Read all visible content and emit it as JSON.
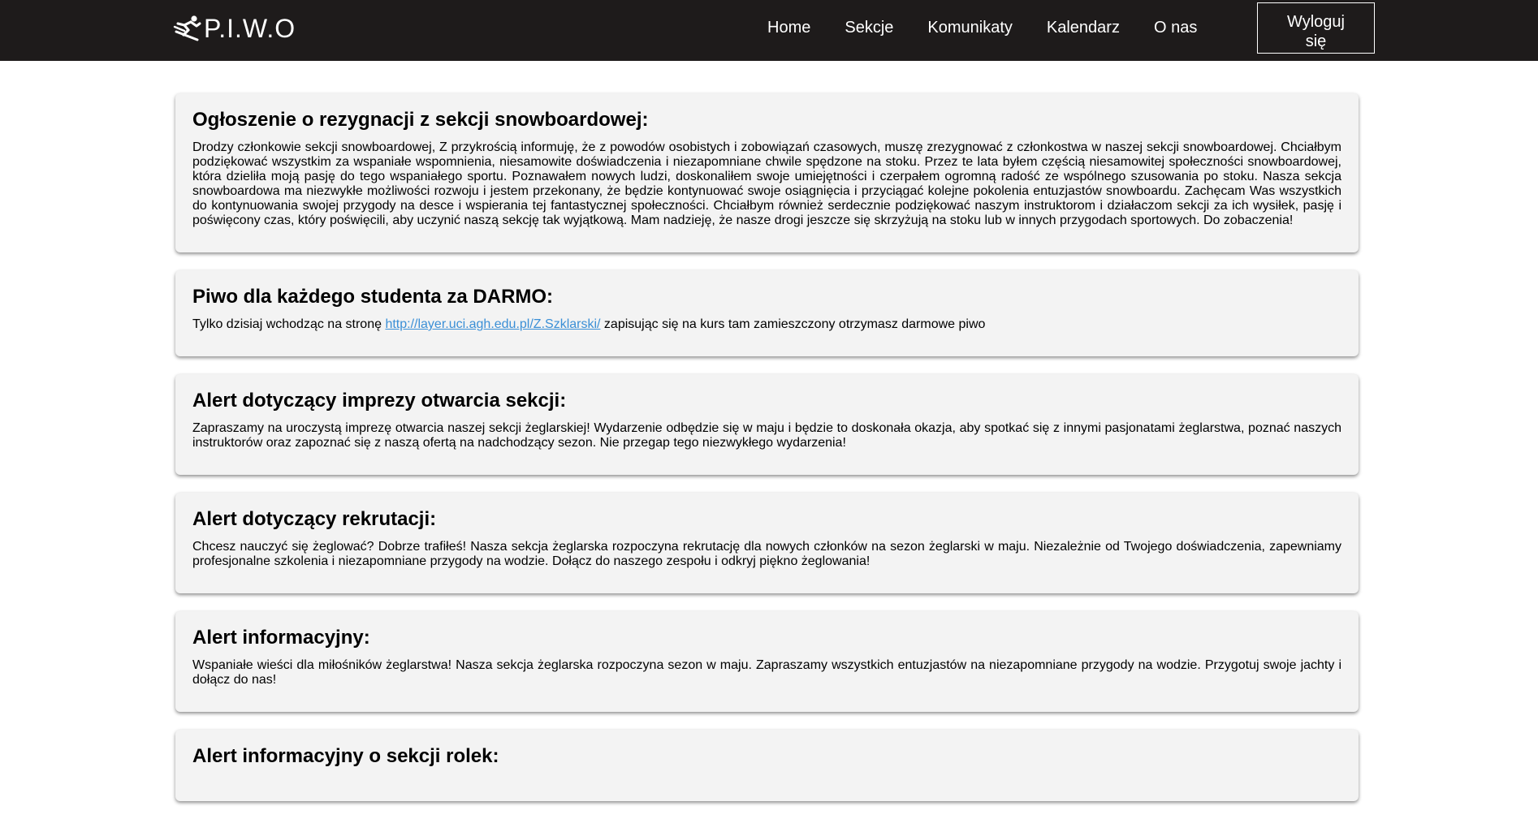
{
  "brand": {
    "icon": "skier-icon",
    "name": "P.I.W.O"
  },
  "nav": {
    "items": [
      {
        "label": "Home"
      },
      {
        "label": "Sekcje"
      },
      {
        "label": "Komunikaty"
      },
      {
        "label": "Kalendarz"
      },
      {
        "label": "O nas"
      }
    ],
    "logout_label_line1": "Wyloguj",
    "logout_label_line2": "się"
  },
  "colors": {
    "navbar_bg": "#1e1b1b",
    "card_bg": "#f3f3f3",
    "link": "#3b8fd6"
  },
  "announcements": [
    {
      "title": "Ogłoszenie o rezygnacji z sekcji snowboardowej:",
      "body": "Drodzy członkowie sekcji snowboardowej, Z przykrością informuję, że z powodów osobistych i zobowiązań czasowych, muszę zrezygnować z członkostwa w naszej sekcji snowboardowej. Chciałbym podziękować wszystkim za wspaniałe wspomnienia, niesamowite doświadczenia i niezapomniane chwile spędzone na stoku. Przez te lata byłem częścią niesamowitej społeczności snowboardowej, która dzieliła moją pasję do tego wspaniałego sportu. Poznawałem nowych ludzi, doskonaliłem swoje umiejętności i czerpałem ogromną radość ze wspólnego szusowania po stoku. Nasza sekcja snowboardowa ma niezwykłe możliwości rozwoju i jestem przekonany, że będzie kontynuować swoje osiągnięcia i przyciągać kolejne pokolenia entuzjastów snowboardu. Zachęcam Was wszystkich do kontynuowania swojej przygody na desce i wspierania tej fantastycznej społeczności. Chciałbym również serdecznie podziękować naszym instruktorom i działaczom sekcji za ich wysiłek, pasję i poświęcony czas, który poświęcili, aby uczynić naszą sekcję tak wyjątkową. Mam nadzieję, że nasze drogi jeszcze się skrzyżują na stoku lub w innych przygodach sportowych. Do zobaczenia!"
    },
    {
      "title": "Piwo dla każdego studenta za DARMO:",
      "body_before": "Tylko dzisiaj wchodząc na stronę ",
      "link_text": "http://layer.uci.agh.edu.pl/Z.Szklarski/",
      "body_after": " zapisując się na kurs tam zamieszczony otrzymasz darmowe piwo"
    },
    {
      "title": "Alert dotyczący imprezy otwarcia sekcji:",
      "body": "Zapraszamy na uroczystą imprezę otwarcia naszej sekcji żeglarskiej! Wydarzenie odbędzie się w maju i będzie to doskonała okazja, aby spotkać się z innymi pasjonatami żeglarstwa, poznać naszych instruktorów oraz zapoznać się z naszą ofertą na nadchodzący sezon. Nie przegap tego niezwykłego wydarzenia!"
    },
    {
      "title": "Alert dotyczący rekrutacji:",
      "body": "Chcesz nauczyć się żeglować? Dobrze trafiłeś! Nasza sekcja żeglarska rozpoczyna rekrutację dla nowych członków na sezon żeglarski w maju. Niezależnie od Twojego doświadczenia, zapewniamy profesjonalne szkolenia i niezapomniane przygody na wodzie. Dołącz do naszego zespołu i odkryj piękno żeglowania!"
    },
    {
      "title": "Alert informacyjny:",
      "body": "Wspaniałe wieści dla miłośników żeglarstwa! Nasza sekcja żeglarska rozpoczyna sezon w maju. Zapraszamy wszystkich entuzjastów na niezapomniane przygody na wodzie. Przygotuj swoje jachty i dołącz do nas!"
    },
    {
      "title": "Alert informacyjny o sekcji rolek:",
      "body": ""
    }
  ]
}
